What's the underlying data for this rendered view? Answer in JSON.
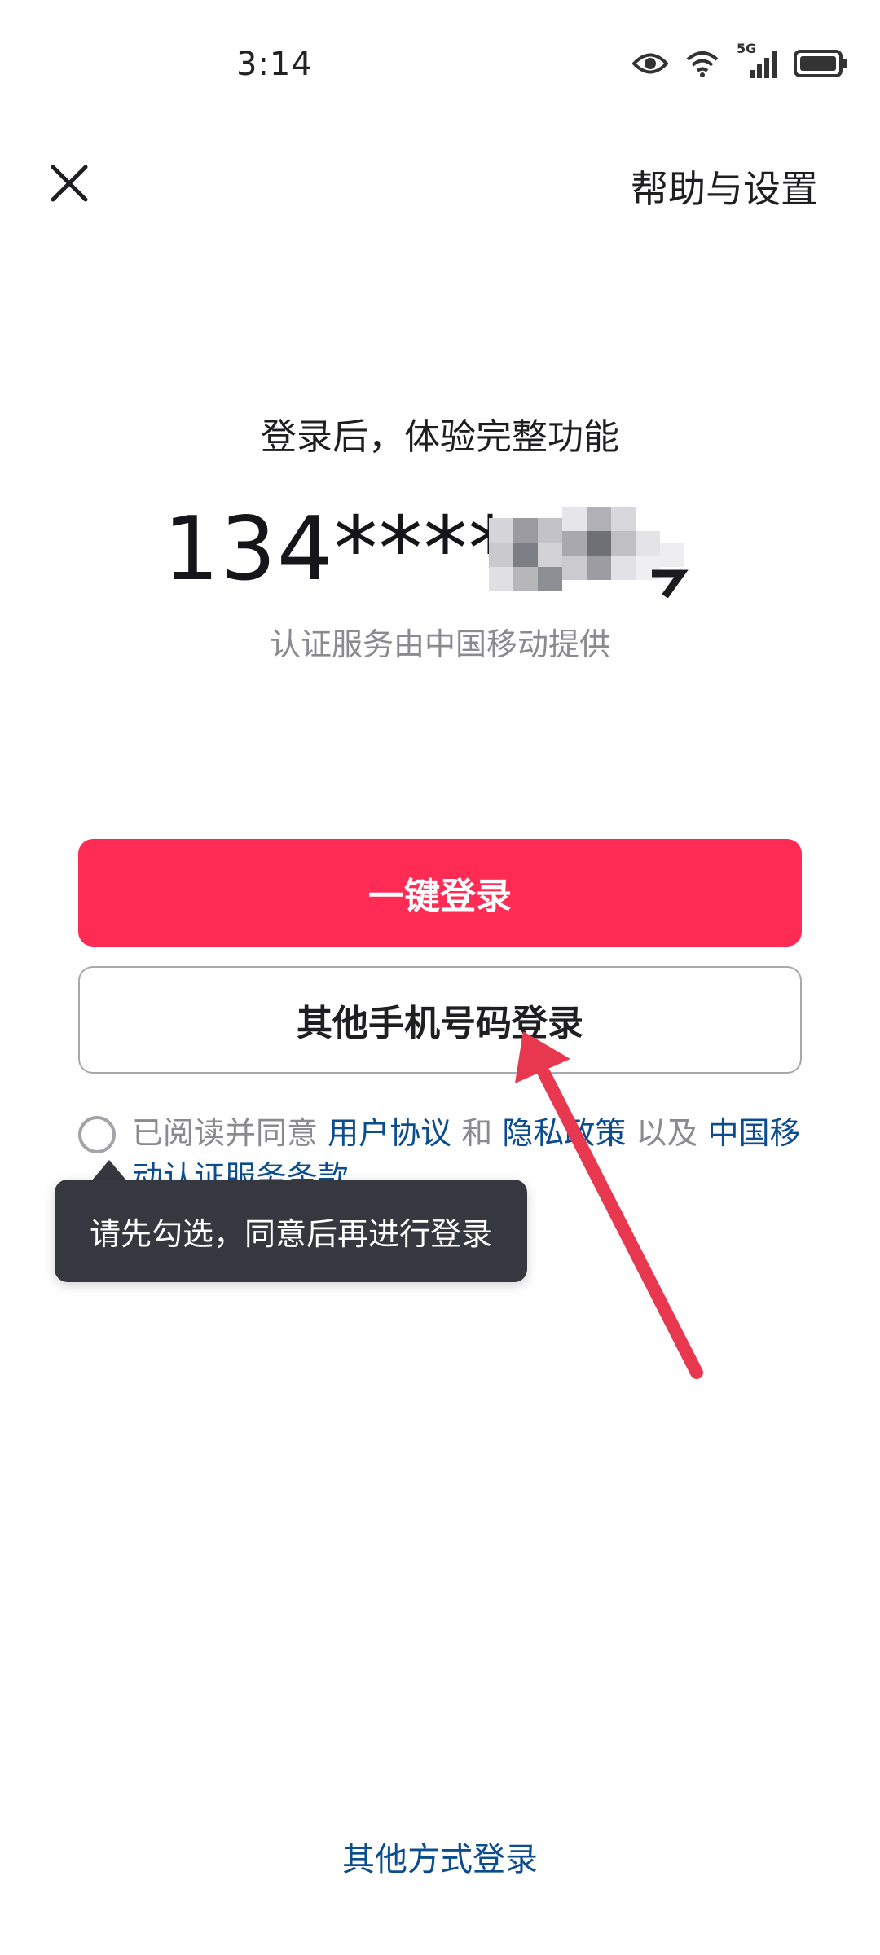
{
  "status_bar": {
    "time": "3:14",
    "network": "5G"
  },
  "header": {
    "close_icon": "close-icon",
    "help_label": "帮助与设置"
  },
  "main": {
    "subtitle": "登录后，体验完整功能",
    "phone_number": "134****",
    "provider_text": "认证服务由中国移动提供"
  },
  "buttons": {
    "one_click_login": "一键登录",
    "other_phone_login": "其他手机号码登录"
  },
  "agreement": {
    "prefix": "已阅读并同意",
    "user_agreement": "用户协议",
    "and": "和",
    "privacy_policy": "隐私政策",
    "as_well_as": "以及",
    "cmcc_terms": "中国移动认证服务条款"
  },
  "tooltip": {
    "text": "请先勾选，同意后再进行登录"
  },
  "footer": {
    "other_methods": "其他方式登录"
  },
  "colors": {
    "primary": "#fe2c55",
    "link": "#0b4d8e",
    "tooltip_bg": "#363840",
    "annotation_arrow": "#e8384f"
  }
}
